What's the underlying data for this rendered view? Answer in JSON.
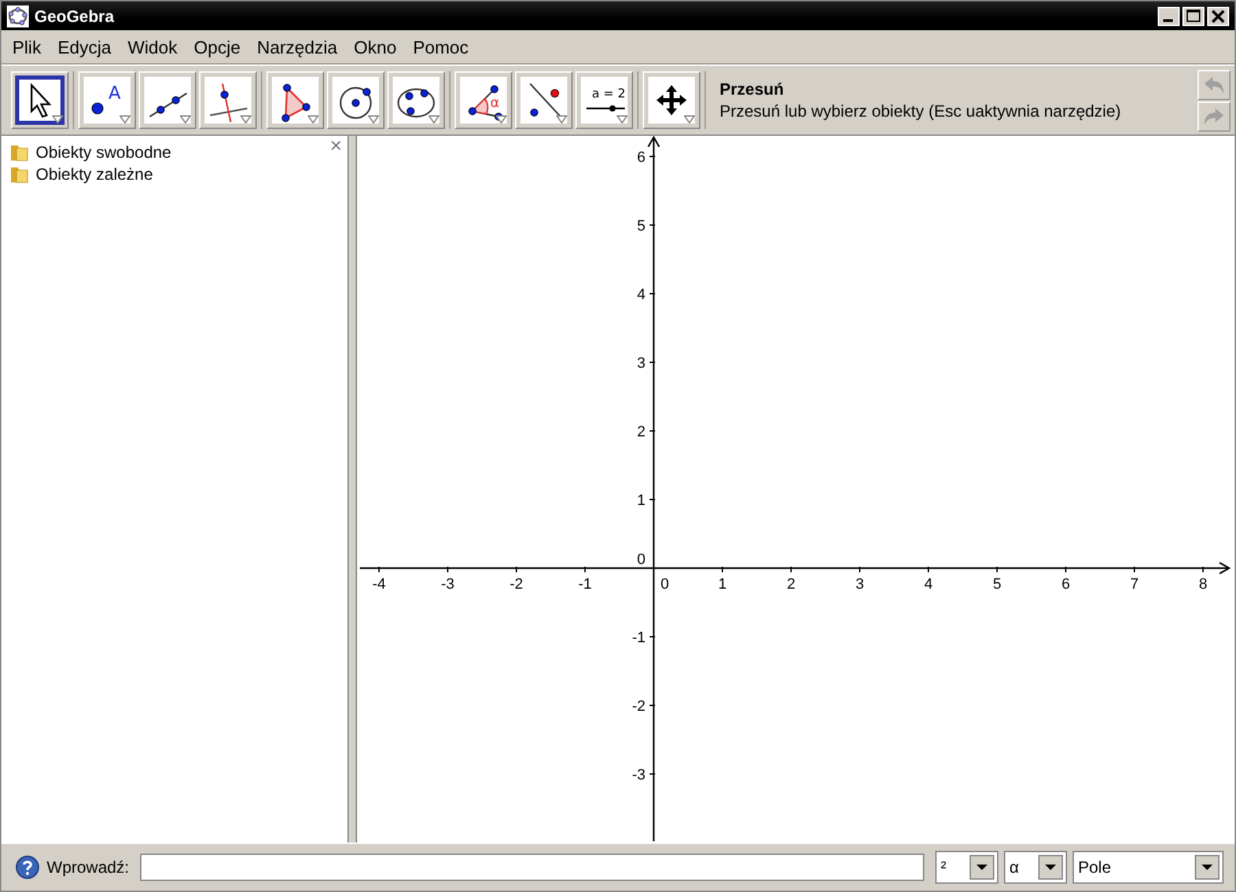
{
  "window": {
    "title": "GeoGebra"
  },
  "menu": [
    "Plik",
    "Edycja",
    "Widok",
    "Opcje",
    "Narzędzia",
    "Okno",
    "Pomoc"
  ],
  "tool_groups": [
    [
      {
        "kind": "move",
        "selected": true
      }
    ],
    [
      {
        "kind": "point",
        "selected": false,
        "label": "A"
      },
      {
        "kind": "line",
        "selected": false
      },
      {
        "kind": "perpendicular",
        "selected": false
      }
    ],
    [
      {
        "kind": "polygon",
        "selected": false
      },
      {
        "kind": "circle",
        "selected": false
      },
      {
        "kind": "conic",
        "selected": false
      }
    ],
    [
      {
        "kind": "angle",
        "selected": false,
        "label": "α"
      },
      {
        "kind": "reflect",
        "selected": false
      },
      {
        "kind": "slider",
        "selected": false,
        "label": "a = 2"
      }
    ],
    [
      {
        "kind": "pan",
        "selected": false
      }
    ]
  ],
  "tool_info": {
    "name": "Przesuń",
    "description": "Przesuń lub wybierz obiekty (Esc uaktywnia narzędzie)"
  },
  "history": {
    "undo_disabled": true,
    "redo_disabled": true
  },
  "algebra": {
    "items": [
      {
        "label": "Obiekty swobodne"
      },
      {
        "label": "Obiekty zależne"
      }
    ],
    "close": "×"
  },
  "graphics": {
    "x_labels": [
      "-4",
      "-3",
      "-2",
      "-1",
      "0",
      "1",
      "2",
      "3",
      "4",
      "5",
      "6",
      "7",
      "8"
    ],
    "y_labels": [
      "6",
      "5",
      "4",
      "3",
      "2",
      "1",
      "0",
      "-1",
      "-2",
      "-3"
    ]
  },
  "input_bar": {
    "label": "Wprowadź:",
    "symbols": [
      "²",
      "α"
    ],
    "commands": "Pole"
  }
}
